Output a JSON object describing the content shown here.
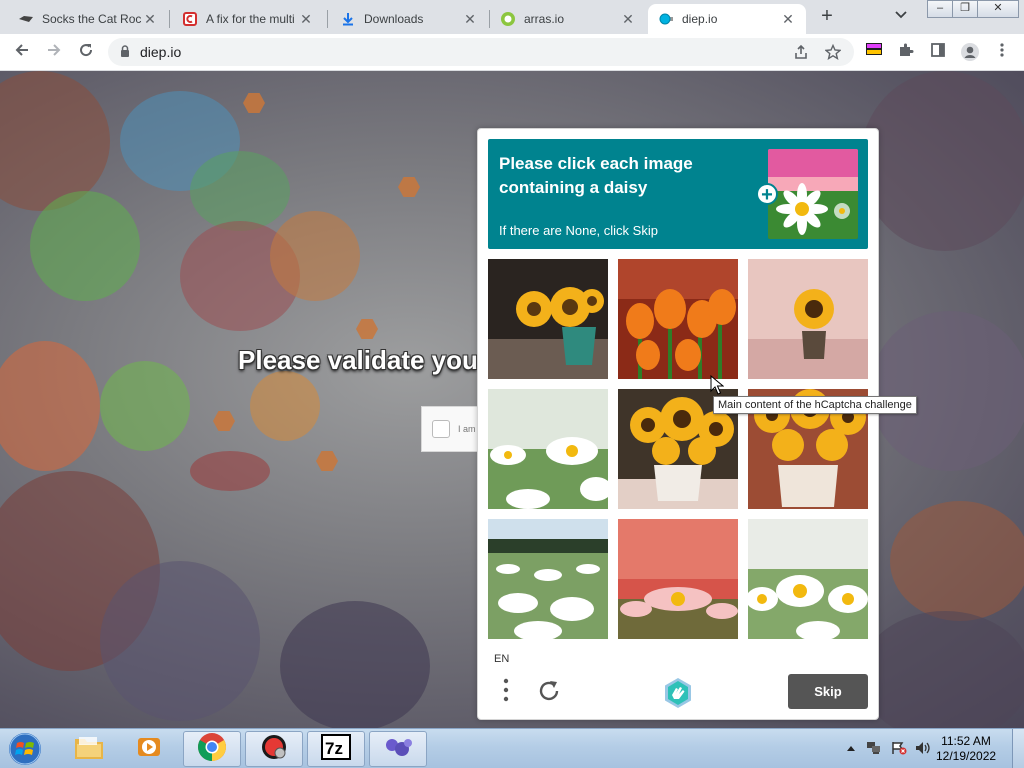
{
  "tabs": [
    {
      "title": "Socks the Cat Roc",
      "icon": "cat-icon"
    },
    {
      "title": "A fix for the multi",
      "icon": "c-logo-icon"
    },
    {
      "title": "Downloads",
      "icon": "download-icon"
    },
    {
      "title": "arras.io",
      "icon": "arras-icon"
    },
    {
      "title": "diep.io",
      "icon": "diep-icon",
      "active": true
    }
  ],
  "window_controls": {
    "minimize": "–",
    "restore": "❐",
    "close": "✕"
  },
  "address_bar": {
    "url": "diep.io"
  },
  "page": {
    "validate_text": "Please validate you",
    "checkbox_label": "I am"
  },
  "captcha": {
    "prompt": "Please click each image containing a daisy",
    "sub": "If there are None, click Skip",
    "language": "EN",
    "skip_label": "Skip",
    "tooltip": "Main content of the hCaptcha challenge",
    "images": [
      {
        "name": "sunflower-vase-teal"
      },
      {
        "name": "orange-tulips"
      },
      {
        "name": "sunflower-pink-wall"
      },
      {
        "name": "daisies-close"
      },
      {
        "name": "sunflowers-white-vase"
      },
      {
        "name": "sunflowers-brick"
      },
      {
        "name": "daisy-field-trees"
      },
      {
        "name": "pink-daisies-red"
      },
      {
        "name": "white-daisies-grass"
      }
    ]
  },
  "taskbar": {
    "time": "11:52 AM",
    "date": "12/19/2022"
  },
  "colors": {
    "captcha_teal": "#00838f",
    "skip_button": "#555555"
  }
}
